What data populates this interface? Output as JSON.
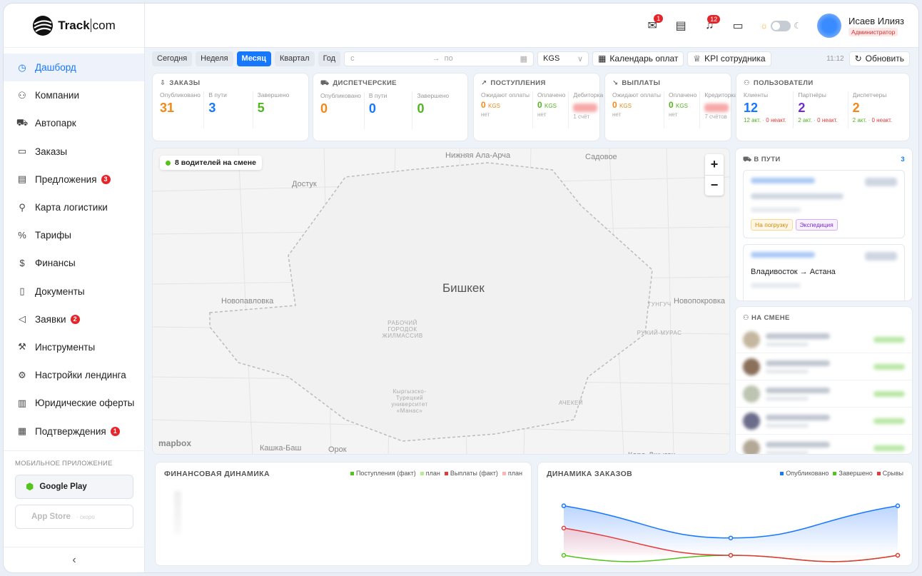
{
  "app": {
    "brand": "Track",
    "brand_suffix": "com"
  },
  "sidebar": {
    "items": [
      {
        "label": "Дашборд",
        "icon": "dashboard-icon",
        "glyph": "◷",
        "active": true
      },
      {
        "label": "Компании",
        "icon": "users-icon",
        "glyph": "⚇"
      },
      {
        "label": "Автопарк",
        "icon": "car-icon",
        "glyph": "⛟"
      },
      {
        "label": "Заказы",
        "icon": "box-icon",
        "glyph": "▭"
      },
      {
        "label": "Предложения",
        "icon": "offer-icon",
        "glyph": "▤",
        "badge": "3"
      },
      {
        "label": "Карта логистики",
        "icon": "route-icon",
        "glyph": "⚲"
      },
      {
        "label": "Тарифы",
        "icon": "percent-icon",
        "glyph": "%"
      },
      {
        "label": "Финансы",
        "icon": "dollar-icon",
        "glyph": "$"
      },
      {
        "label": "Документы",
        "icon": "document-icon",
        "glyph": "▯"
      },
      {
        "label": "Заявки",
        "icon": "megaphone-icon",
        "glyph": "◁",
        "badge": "2"
      },
      {
        "label": "Инструменты",
        "icon": "wrench-icon",
        "glyph": "⚒"
      },
      {
        "label": "Настройки лендинга",
        "icon": "settings-icon",
        "glyph": "⚙"
      },
      {
        "label": "Юридические оферты",
        "icon": "legal-icon",
        "glyph": "▥"
      },
      {
        "label": "Подтверждения",
        "icon": "confirm-icon",
        "glyph": "▦",
        "badge": "1"
      }
    ],
    "mobile_caption": "МОБИЛЬНОЕ ПРИЛОЖЕНИЕ",
    "google_play": "Google Play",
    "app_store": "App Store",
    "app_store_note": "· скоро"
  },
  "topbar": {
    "mail_badge": "1",
    "bell_badge": "12",
    "user_name": "Исаев Илияз",
    "user_role": "Администратор"
  },
  "filters": {
    "periods": [
      "Сегодня",
      "Неделя",
      "Месяц",
      "Квартал",
      "Год"
    ],
    "active_period": "Месяц",
    "date_from": "с",
    "date_arrow": "→",
    "date_to": "по",
    "currency": "KGS",
    "payments_calendar": "Календарь оплат",
    "kpi": "KPI сотрудника",
    "time": "11:12",
    "refresh": "Обновить"
  },
  "kpi": {
    "orders": {
      "title": "ЗАКАЗЫ",
      "cols": [
        {
          "label": "Опубликовано",
          "value": "31",
          "color": "orange"
        },
        {
          "label": "В пути",
          "value": "3",
          "color": "blue"
        },
        {
          "label": "Завершено",
          "value": "5",
          "color": "green"
        }
      ]
    },
    "dispatch": {
      "title": "ДИСПЕТЧЕРСКИЕ",
      "cols": [
        {
          "label": "Опубликовано",
          "value": "0",
          "color": "orange"
        },
        {
          "label": "В пути",
          "value": "0",
          "color": "blue"
        },
        {
          "label": "Завершено",
          "value": "0",
          "color": "green"
        }
      ]
    },
    "income": {
      "title": "ПОСТУПЛЕНИЯ",
      "cols": [
        {
          "label": "Ожидают оплаты",
          "value": "0",
          "unit": "KGS",
          "sub": "нет",
          "color": "orange"
        },
        {
          "label": "Оплачено",
          "value": "0",
          "unit": "KGS",
          "sub": "нет",
          "color": "green"
        },
        {
          "label": "Дебиторка",
          "value": "",
          "sub": "1 счёт",
          "color": "red",
          "blur": true
        }
      ]
    },
    "payouts": {
      "title": "ВЫПЛАТЫ",
      "cols": [
        {
          "label": "Ожидают оплаты",
          "value": "0",
          "unit": "KGS",
          "sub": "нет",
          "color": "orange"
        },
        {
          "label": "Оплачено",
          "value": "0",
          "unit": "KGS",
          "sub": "нет",
          "color": "green"
        },
        {
          "label": "Кредиторка",
          "value": "",
          "sub": "7 счётов",
          "color": "red",
          "blur": true
        }
      ]
    },
    "users": {
      "title": "ПОЛЬЗОВАТЕЛИ",
      "cols": [
        {
          "label": "Клиенты",
          "value": "12",
          "color": "blue",
          "act": "12 акт.",
          "inact": "0 неакт."
        },
        {
          "label": "Партнёры",
          "value": "2",
          "color": "purple",
          "act": "2 акт.",
          "inact": "0 неакт."
        },
        {
          "label": "Диспетчеры",
          "value": "2",
          "color": "orange",
          "act": "2 акт.",
          "inact": "0 неакт."
        }
      ]
    }
  },
  "map": {
    "drivers": "8 водителей на смене",
    "city": "Бишкек",
    "labels": [
      {
        "t": "Нижняя Ала-Арча",
        "cls": ""
      },
      {
        "t": "Садовое",
        "cls": ""
      },
      {
        "t": "Достук",
        "cls": ""
      },
      {
        "t": "Новопавловка",
        "cls": ""
      },
      {
        "t": "Новопокровка",
        "cls": ""
      },
      {
        "t": "Кашка-Баш",
        "cls": ""
      },
      {
        "t": "Орок",
        "cls": ""
      },
      {
        "t": "Кара-Джыгач",
        "cls": ""
      },
      {
        "t": "РАБОЧИЙ ГОРОДОК ЖИЛМАССИВ",
        "cls": "sm"
      },
      {
        "t": "ТУНГУЧ",
        "cls": "sm"
      },
      {
        "t": "РУХИЙ-МУРАС",
        "cls": "sm"
      },
      {
        "t": "АЧЕКЕЙ",
        "cls": "sm"
      },
      {
        "t": "Кыргызско-Турецкий университет «Манас»",
        "cls": "sm"
      }
    ],
    "attribution": "mapbox"
  },
  "in_transit": {
    "title": "В ПУТИ",
    "count": "3",
    "route": "Владивосток → Астана",
    "tag1": "На погрузку",
    "tag2": "Экспедиция"
  },
  "on_shift": {
    "title": "НА СМЕНЕ"
  },
  "fin_chart": {
    "title": "ФИНАНСОВАЯ ДИНАМИКА",
    "legend": [
      {
        "t": "Поступления (факт)",
        "c": "#52c41a"
      },
      {
        "t": "план",
        "c": "#b7eb8f"
      },
      {
        "t": "Выплаты (факт)",
        "c": "#e03a3a"
      },
      {
        "t": "план",
        "c": "#ffb3b3"
      }
    ]
  },
  "orders_chart": {
    "title": "ДИНАМИКА ЗАКАЗОВ",
    "legend": [
      {
        "t": "Опубликовано",
        "c": "#1677ff"
      },
      {
        "t": "Завершено",
        "c": "#52c41a"
      },
      {
        "t": "Срывы",
        "c": "#e03a3a"
      }
    ]
  },
  "chart_data": {
    "type": "line",
    "x": [
      0,
      1,
      2
    ],
    "series": [
      {
        "name": "Опубликовано",
        "values": [
          4,
          1.4,
          4
        ]
      },
      {
        "name": "Завершено",
        "values": [
          0,
          0,
          0
        ]
      },
      {
        "name": "Срывы",
        "values": [
          2.2,
          0,
          0
        ]
      }
    ],
    "ylim": [
      0,
      4.5
    ],
    "title": "ДИНАМИКА ЗАКАЗОВ"
  }
}
